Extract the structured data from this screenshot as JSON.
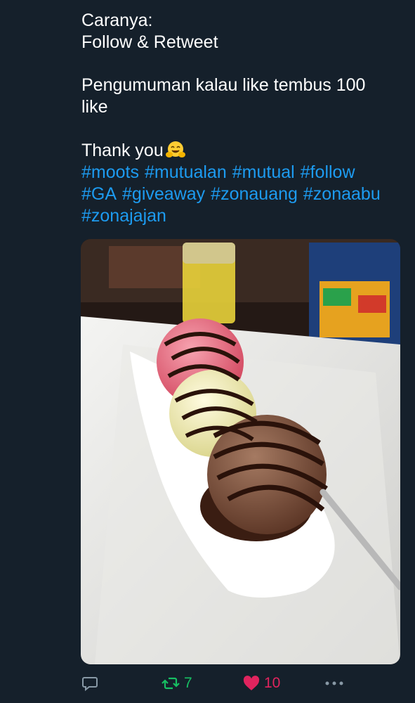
{
  "tweet": {
    "lines": {
      "l1": "Caranya:",
      "l2": "Follow & Retweet",
      "l3": "Pengumuman kalau like tembus 100",
      "l4": "like",
      "l5": "Thank you"
    },
    "emoji": "smiling-face-with-open-hands-icon",
    "hashtags": {
      "h1": "#moots",
      "h2": "#mutualan",
      "h3": "#mutual",
      "h4": "#follow",
      "h5": "#GA",
      "h6": "#giveaway",
      "h7": "#zonauang",
      "h8": "#zonaabu",
      "h9": "#zonajajan"
    },
    "hashtag_color": "#1d9bf0"
  },
  "actions": {
    "reply_icon": "reply-icon",
    "retweet_count": "7",
    "retweet_color": "#17bf63",
    "like_count": "10",
    "like_color": "#e0245e",
    "more_icon": "more-icon"
  },
  "theme": {
    "background": "#15202b",
    "text": "#ffffff",
    "muted": "#8899a6"
  }
}
